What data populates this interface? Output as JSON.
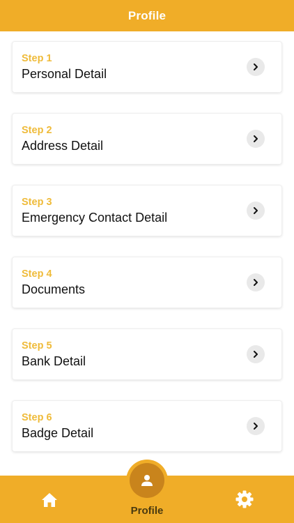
{
  "header": {
    "title": "Profile"
  },
  "steps": [
    {
      "step": "Step 1",
      "title": "Personal Detail"
    },
    {
      "step": "Step 2",
      "title": "Address Detail"
    },
    {
      "step": "Step 3",
      "title": "Emergency Contact Detail"
    },
    {
      "step": "Step 4",
      "title": "Documents"
    },
    {
      "step": "Step 5",
      "title": "Bank Detail"
    },
    {
      "step": "Step 6",
      "title": "Badge Detail"
    }
  ],
  "bottom_nav": {
    "home_icon": "home-icon",
    "profile_icon": "person-icon",
    "profile_label": "Profile",
    "settings_icon": "gear-icon"
  },
  "colors": {
    "accent": "#f0ad28",
    "step_label": "#efbb3a",
    "profile_fab": "#c9841c",
    "chevron_bg": "#e9e9e9"
  }
}
